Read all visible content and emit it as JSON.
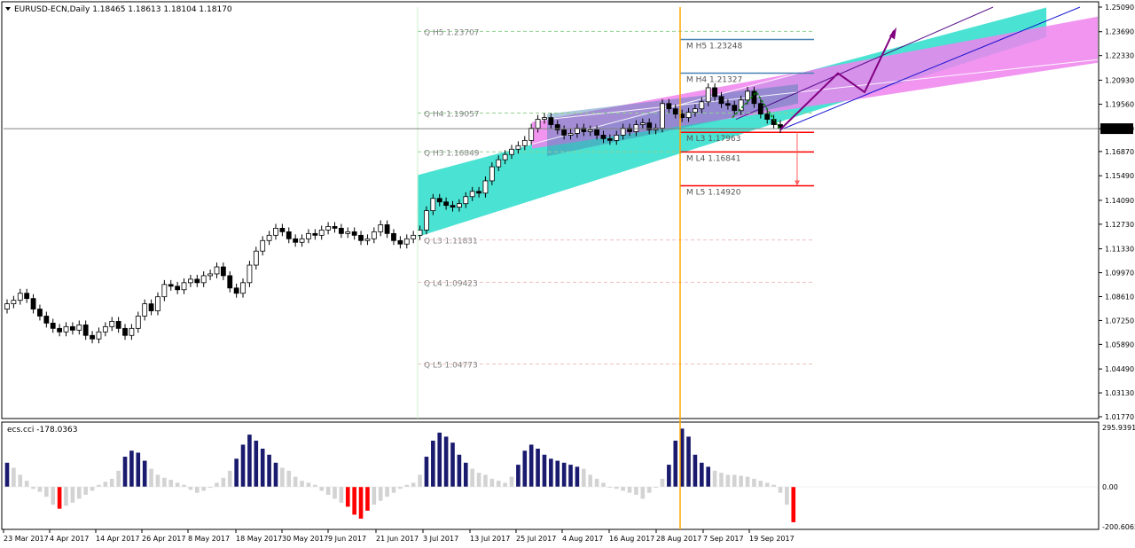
{
  "header": {
    "symbol_line": "EURUSD-ECN,Daily  1.18465 1.18613 1.18104 1.18170",
    "indicator_label": "ecs.cci -178.0363"
  },
  "colors": {
    "bull_candle": "#ffffff",
    "bear_candle": "#000000",
    "upper_channel": "#40e0d0",
    "lower_channel": "#ee82ee",
    "bars_strong": "#1a1a6e",
    "bars_neutral": "#d3d3d3",
    "bars_negative": "#ff0000",
    "vertical_line": "#ffa500",
    "price_line": "#808080",
    "forecast_arrow": "#800080"
  },
  "price_axis": {
    "labels": [
      "1.25090",
      "1.23690",
      "1.22330",
      "1.20930",
      "1.19560",
      "1.18170",
      "1.16870",
      "1.15490",
      "1.14090",
      "1.12730",
      "1.11330",
      "1.09970",
      "1.08610",
      "1.07250",
      "1.05890",
      "1.04490",
      "1.03130",
      "1.01770"
    ],
    "current_price": "1.18170"
  },
  "indicator_axis": {
    "labels": [
      "295.9391",
      "0.00",
      "-200.6065"
    ]
  },
  "time_axis": {
    "labels": [
      "23 Mar 2017",
      "4 Apr 2017",
      "14 Apr 2017",
      "26 Apr 2017",
      "8 May 2017",
      "18 May 2017",
      "30 May 2017",
      "9 Jun 2017",
      "21 Jun 2017",
      "3 Jul 2017",
      "13 Jul 2017",
      "25 Jul 2017",
      "4 Aug 2017",
      "16 Aug 2017",
      "28 Aug 2017",
      "7 Sep 2017",
      "19 Sep 2017"
    ]
  },
  "levels_q": [
    {
      "label": "Q  H5 1.23707"
    },
    {
      "label": "Q  H4 1.19057"
    },
    {
      "label": "Q  H3 1.16849"
    },
    {
      "label": "Q  L3 1.11831"
    },
    {
      "label": "Q  L4 1.09423"
    },
    {
      "label": "Q  L5 1.04773"
    }
  ],
  "levels_m": [
    {
      "label": "M  H5 1.23248"
    },
    {
      "label": "M  H4 1.21327"
    },
    {
      "label": "M  L3 1.17963"
    },
    {
      "label": "M  L4 1.16841"
    },
    {
      "label": "M  L5 1.14920"
    }
  ],
  "chart_data": {
    "type": "candlestick",
    "symbol": "EURUSD-ECN",
    "timeframe": "Daily",
    "last_ohlc": {
      "open": 1.18465,
      "high": 1.18613,
      "low": 1.18104,
      "close": 1.1817
    },
    "x_labels": [
      "23 Mar 2017",
      "4 Apr 2017",
      "14 Apr 2017",
      "26 Apr 2017",
      "8 May 2017",
      "18 May 2017",
      "30 May 2017",
      "9 Jun 2017",
      "21 Jun 2017",
      "3 Jul 2017",
      "13 Jul 2017",
      "25 Jul 2017",
      "4 Aug 2017",
      "16 Aug 2017",
      "28 Aug 2017",
      "7 Sep 2017",
      "19 Sep 2017"
    ],
    "ylim": [
      1.0177,
      1.2509
    ],
    "indicator_ylim": [
      -200.6065,
      295.9391
    ],
    "closes": [
      1.082,
      1.084,
      1.088,
      1.085,
      1.079,
      1.075,
      1.071,
      1.068,
      1.066,
      1.069,
      1.067,
      1.07,
      1.064,
      1.062,
      1.066,
      1.069,
      1.072,
      1.068,
      1.064,
      1.068,
      1.075,
      1.082,
      1.078,
      1.086,
      1.093,
      1.092,
      1.09,
      1.094,
      1.096,
      1.094,
      1.098,
      1.099,
      1.103,
      1.098,
      1.091,
      1.088,
      1.094,
      1.104,
      1.112,
      1.118,
      1.121,
      1.125,
      1.123,
      1.119,
      1.117,
      1.119,
      1.122,
      1.121,
      1.124,
      1.126,
      1.125,
      1.122,
      1.123,
      1.121,
      1.118,
      1.119,
      1.123,
      1.127,
      1.122,
      1.118,
      1.116,
      1.119,
      1.121,
      1.124,
      1.135,
      1.142,
      1.14,
      1.138,
      1.137,
      1.139,
      1.143,
      1.146,
      1.145,
      1.152,
      1.16,
      1.164,
      1.167,
      1.17,
      1.172,
      1.175,
      1.182,
      1.187,
      1.188,
      1.184,
      1.181,
      1.178,
      1.179,
      1.182,
      1.18,
      1.181,
      1.178,
      1.176,
      1.175,
      1.178,
      1.182,
      1.18,
      1.184,
      1.185,
      1.181,
      1.182,
      1.196,
      1.193,
      1.19,
      1.188,
      1.191,
      1.193,
      1.197,
      1.205,
      1.2,
      1.196,
      1.195,
      1.192,
      1.198,
      1.203,
      1.196,
      1.19,
      1.187,
      1.184,
      1.1817
    ],
    "cci": [
      120,
      95,
      60,
      30,
      -10,
      -25,
      -50,
      -90,
      -110,
      -95,
      -80,
      -60,
      -40,
      -20,
      10,
      25,
      40,
      80,
      150,
      180,
      170,
      130,
      90,
      60,
      45,
      35,
      20,
      10,
      -15,
      -30,
      -20,
      -5,
      20,
      45,
      80,
      140,
      210,
      260,
      230,
      190,
      160,
      120,
      95,
      80,
      50,
      30,
      20,
      10,
      -20,
      -40,
      -60,
      -80,
      -100,
      -140,
      -160,
      -120,
      -90,
      -70,
      -50,
      -30,
      -10,
      10,
      20,
      60,
      150,
      230,
      270,
      250,
      220,
      160,
      120,
      90,
      70,
      60,
      40,
      30,
      20,
      50,
      110,
      180,
      210,
      190,
      160,
      140,
      130,
      120,
      110,
      100,
      90,
      60,
      40,
      20,
      0,
      -10,
      -20,
      -30,
      -40,
      -60,
      -30,
      0,
      40,
      110,
      230,
      290,
      250,
      160,
      120,
      100,
      80,
      70,
      60,
      60,
      55,
      50,
      40,
      30,
      20,
      10,
      -30,
      -90,
      -178.0363
    ]
  }
}
